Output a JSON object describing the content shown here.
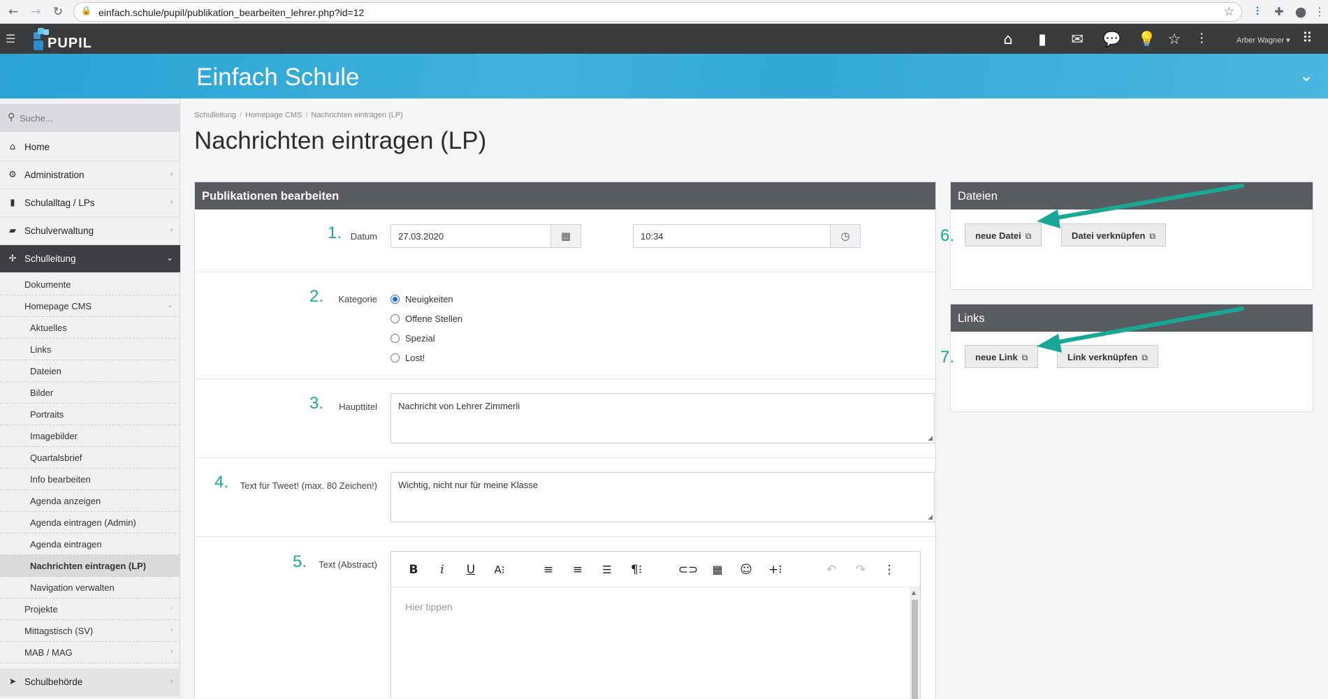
{
  "browser": {
    "url": "einfach.schule/pupil/publikation_bearbeiten_lehrer.php?id=12"
  },
  "app": {
    "logo_text": "PUPIL",
    "user_name": "Arber Wagner ▾",
    "banner_title": "Einfach Schule"
  },
  "sidebar": {
    "search_placeholder": "Suche...",
    "main_items": [
      {
        "label": "Home",
        "icon": "home-icon"
      },
      {
        "label": "Administration",
        "icon": "cogs-icon"
      },
      {
        "label": "Schulalltag / LPs",
        "icon": "bookmark-icon"
      },
      {
        "label": "Schulverwaltung",
        "icon": "folder-icon"
      },
      {
        "label": "Schulleitung",
        "icon": "signpost-icon"
      }
    ],
    "sub_items": [
      {
        "label": "Dokumente"
      },
      {
        "label": "Homepage CMS"
      },
      {
        "label": "Aktuelles"
      },
      {
        "label": "Links"
      },
      {
        "label": "Dateien"
      },
      {
        "label": "Bilder"
      },
      {
        "label": "Portraits"
      },
      {
        "label": "Imagebilder"
      },
      {
        "label": "Quartalsbrief"
      },
      {
        "label": "Info bearbeiten"
      },
      {
        "label": "Agenda anzeigen"
      },
      {
        "label": "Agenda eintragen (Admin)"
      },
      {
        "label": "Agenda eintragen"
      },
      {
        "label": "Nachrichten eintragen (LP)"
      },
      {
        "label": "Navigation verwalten"
      },
      {
        "label": "Projekte"
      },
      {
        "label": "Mittagstisch (SV)"
      },
      {
        "label": "MAB / MAG"
      }
    ],
    "bottom_item": {
      "label": "Schulbehörde",
      "icon": "paper-plane-icon"
    }
  },
  "breadcrumb": [
    "Schulleitung",
    "Homepage CMS",
    "Nachrichten eintragen (LP)"
  ],
  "page_title": "Nachrichten eintragen (LP)",
  "form": {
    "panel_title": "Publikationen bearbeiten",
    "fields": {
      "datum": {
        "number": "1.",
        "label": "Datum",
        "date_value": "27.03.2020",
        "time_value": "10:34"
      },
      "kategorie": {
        "number": "2.",
        "label": "Kategorie",
        "options": [
          "Neuigkeiten",
          "Offene Stellen",
          "Spezial",
          "Lost!"
        ],
        "selected": "Neuigkeiten"
      },
      "haupttitel": {
        "number": "3.",
        "label": "Haupttitel",
        "value": "Nachricht von Lehrer Zimmerli"
      },
      "tweet": {
        "number": "4.",
        "label": "Text für Tweet! (max. 80 Zeichen!)",
        "value": "Wichtig, nicht nur für meine Klasse"
      },
      "abstract": {
        "number": "5.",
        "label": "Text (Abstract)",
        "placeholder": "Hier tippen"
      }
    }
  },
  "dateien": {
    "panel_title": "Dateien",
    "number": "6.",
    "new_label": "neue Datei",
    "link_label": "Datei verknüpfen"
  },
  "links": {
    "panel_title": "Links",
    "number": "7.",
    "new_label": "neue Link",
    "link_label": "Link verknüpfen"
  },
  "colors": {
    "accent": "#29a3d3",
    "dark_bar": "#3a3b3d",
    "panel_head": "#585b60",
    "annotation": "#1aa896"
  }
}
